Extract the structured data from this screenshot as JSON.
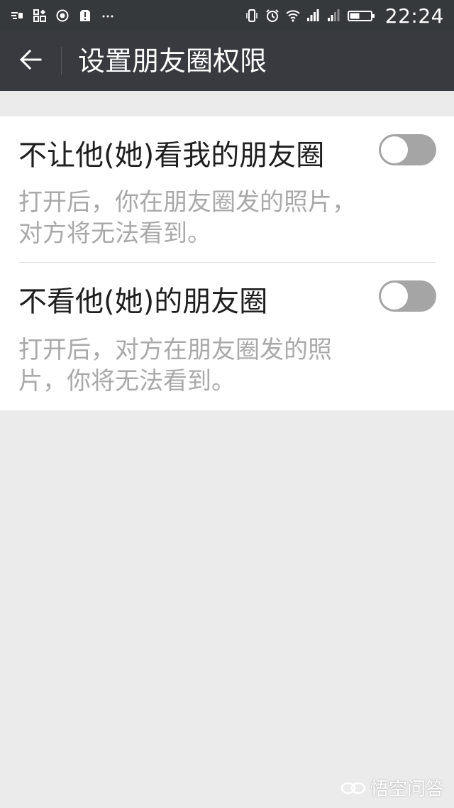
{
  "status_bar": {
    "time": "22:24",
    "left_icons": [
      "sim-icon",
      "apps-icon",
      "circle-icon",
      "alert-icon",
      "more-icon"
    ],
    "right_icons": [
      "vibrate-icon",
      "alarm-icon",
      "wifi-icon",
      "signal-1-icon",
      "signal-2-icon",
      "battery-icon"
    ],
    "colors": {
      "background": "#36393c",
      "text": "#ffffff"
    }
  },
  "app_bar": {
    "title": "设置朋友圈权限",
    "back_icon": "back-arrow-icon",
    "colors": {
      "background": "#393a3f",
      "text": "#ffffff"
    }
  },
  "settings": [
    {
      "title": "不让他(她)看我的朋友圈",
      "desc_line1": "打开后，你在朋友圈发的照片，",
      "desc_line2": "对方将无法看到。",
      "enabled": false
    },
    {
      "title": "不看他(她)的朋友圈",
      "desc_line1": "打开后，对方在朋友圈发的照",
      "desc_line2": "片，你将无法看到。",
      "enabled": false
    }
  ],
  "watermark": {
    "text": "悟空问答"
  },
  "colors": {
    "page_background": "#ebebeb",
    "toggle_off": "#a5a5a5",
    "description": "#a9a9a9"
  }
}
